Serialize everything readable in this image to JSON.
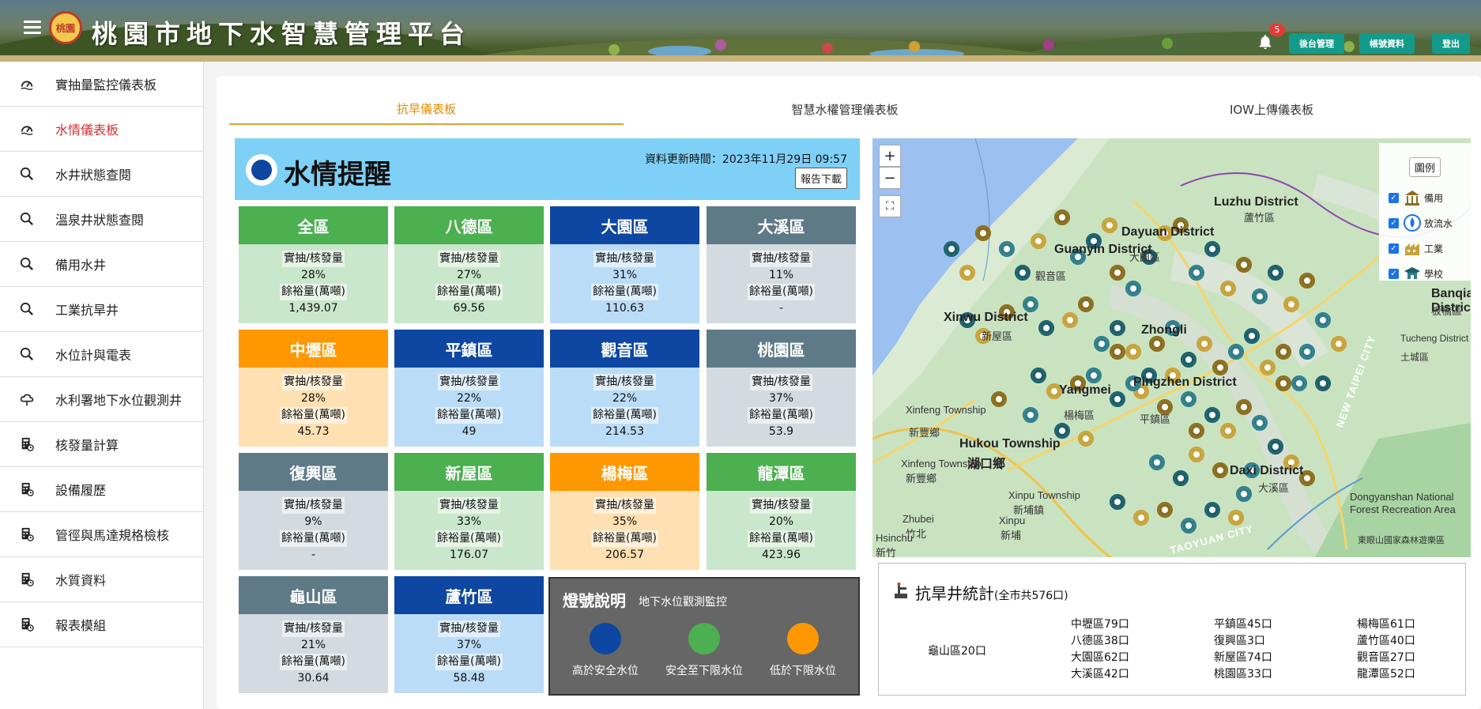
{
  "header": {
    "title": "桃園市地下水智慧管理平台",
    "logo_text": "桃園",
    "notification_count": "5",
    "buttons": [
      "後台管理",
      "帳號資料",
      "登出"
    ]
  },
  "sidebar": {
    "items": [
      {
        "label": "實抽量監控儀表板",
        "icon": "gauge-icon",
        "active": false
      },
      {
        "label": "水情儀表板",
        "icon": "gauge-icon",
        "active": true
      },
      {
        "label": "水井狀態查閱",
        "icon": "search-icon",
        "active": false
      },
      {
        "label": "溫泉井狀態查閱",
        "icon": "search-icon",
        "active": false
      },
      {
        "label": "備用水井",
        "icon": "search-icon",
        "active": false
      },
      {
        "label": "工業抗旱井",
        "icon": "search-icon",
        "active": false
      },
      {
        "label": "水位計與電表",
        "icon": "search-icon",
        "active": false
      },
      {
        "label": "水利署地下水位觀測井",
        "icon": "cloud-icon",
        "active": false
      },
      {
        "label": "核發量計算",
        "icon": "calculator-icon",
        "active": false
      },
      {
        "label": "設備履歷",
        "icon": "calculator-icon",
        "active": false
      },
      {
        "label": "管徑與馬達規格檢核",
        "icon": "calculator-icon",
        "active": false
      },
      {
        "label": "水質資料",
        "icon": "calculator-icon",
        "active": false
      },
      {
        "label": "報表模組",
        "icon": "calculator-icon",
        "active": false
      }
    ]
  },
  "tabs": [
    {
      "label": "抗旱儀表板",
      "active": true
    },
    {
      "label": "智慧水權管理儀表板",
      "active": false
    },
    {
      "label": "IOW上傳儀表板",
      "active": false
    }
  ],
  "water": {
    "title": "水情提醒",
    "update_time": "資料更新時間：2023年11月29日 09:57",
    "report_button": "報告下載",
    "ratio_label": "實抽/核發量",
    "remain_label": "餘裕量(萬噸)",
    "colors": {
      "green": "#4caf50",
      "blue": "#0d47a1",
      "gray": "#5f7a87",
      "orange": "#ff9800"
    },
    "districts": [
      {
        "name": "全區",
        "status": "green",
        "ratio": "28%",
        "remain": "1,439.07"
      },
      {
        "name": "八德區",
        "status": "green",
        "ratio": "27%",
        "remain": "69.56"
      },
      {
        "name": "大園區",
        "status": "blue",
        "ratio": "31%",
        "remain": "110.63"
      },
      {
        "name": "大溪區",
        "status": "gray",
        "ratio": "11%",
        "remain": "-"
      },
      {
        "name": "中壢區",
        "status": "orange",
        "ratio": "28%",
        "remain": "45.73"
      },
      {
        "name": "平鎮區",
        "status": "blue",
        "ratio": "22%",
        "remain": "49"
      },
      {
        "name": "觀音區",
        "status": "blue",
        "ratio": "22%",
        "remain": "214.53"
      },
      {
        "name": "桃園區",
        "status": "gray",
        "ratio": "37%",
        "remain": "53.9"
      },
      {
        "name": "復興區",
        "status": "gray",
        "ratio": "9%",
        "remain": "-"
      },
      {
        "name": "新屋區",
        "status": "green",
        "ratio": "33%",
        "remain": "176.07"
      },
      {
        "name": "楊梅區",
        "status": "orange",
        "ratio": "35%",
        "remain": "206.57"
      },
      {
        "name": "龍潭區",
        "status": "green",
        "ratio": "20%",
        "remain": "423.96"
      },
      {
        "name": "龜山區",
        "status": "gray",
        "ratio": "21%",
        "remain": "30.64"
      },
      {
        "name": "蘆竹區",
        "status": "blue",
        "ratio": "37%",
        "remain": "58.48"
      }
    ],
    "legend": {
      "title": "燈號說明",
      "subtitle": "地下水位觀測監控",
      "items": [
        {
          "label": "高於安全水位",
          "color": "#0d47a1"
        },
        {
          "label": "安全至下限水位",
          "color": "#4caf50"
        },
        {
          "label": "低於下限水位",
          "color": "#ff9800"
        }
      ]
    }
  },
  "map": {
    "zoom_in": "+",
    "zoom_out": "−",
    "legend_title": "圖例",
    "legend_items": [
      "備用",
      "放流水",
      "工業",
      "學校"
    ],
    "labels": [
      "Luzhu District",
      "蘆竹區",
      "Guanyin District",
      "觀音區",
      "Dayuan District",
      "大園區",
      "Xinwu District",
      "新屋區",
      "Pingzhen District",
      "平鎮區",
      "Zhongli",
      "Yangmei",
      "楊梅區",
      "Xinfeng Township",
      "新豐鄉",
      "Hukou Township",
      "湖口鄉",
      "Xinfeng Township",
      "新豐鄉",
      "Xinpu Township",
      "新埔鎮",
      "Zhubei",
      "竹北",
      "Xinpu",
      "新埔",
      "Hsinchu",
      "新竹",
      "Daxi District",
      "大溪區",
      "Dongyanshan National Forest Recreation Area",
      "東眼山國家森林遊樂區",
      "Tucheng District",
      "土城區",
      "Banqiao District",
      "板橋區",
      "NEW TAIPEI CITY",
      "TAOYUAN CITY"
    ]
  },
  "stats": {
    "title": "抗旱井統計",
    "total": "(全市共576口)",
    "single": "龜山區20口",
    "columns": [
      [
        "中壢區79口",
        "八德區38口",
        "大園區62口",
        "大溪區42口"
      ],
      [
        "平鎮區45口",
        "復興區3口",
        "新屋區74口",
        "桃園區33口"
      ],
      [
        "楊梅區61口",
        "蘆竹區40口",
        "觀音區27口",
        "龍潭區52口"
      ]
    ]
  }
}
